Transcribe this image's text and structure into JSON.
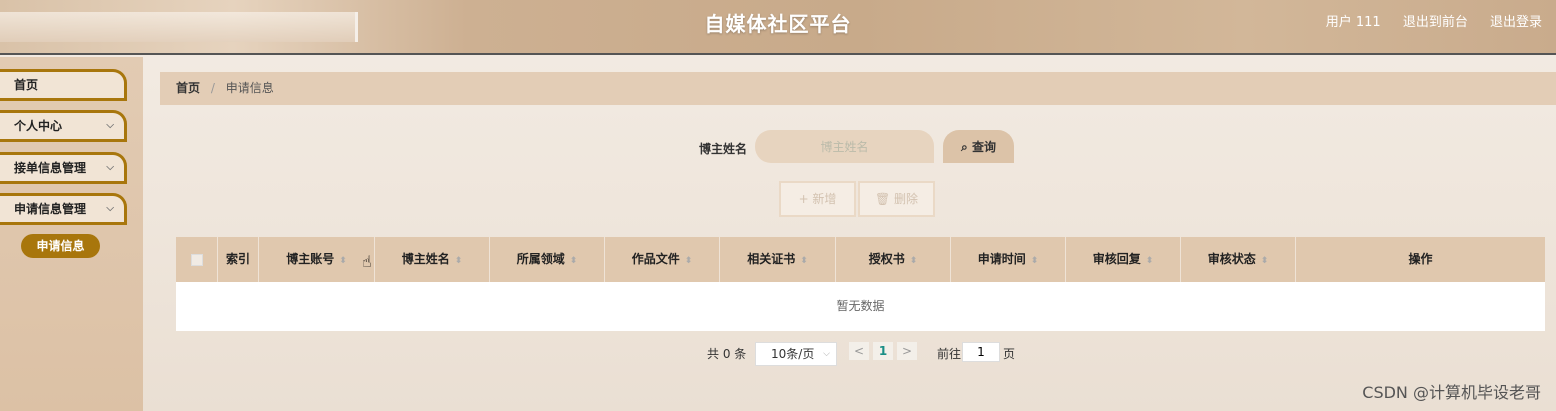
{
  "header": {
    "title": "自媒体社区平台",
    "user": "用户 111",
    "to_front": "退出到前台",
    "logout": "退出登录"
  },
  "sidebar": {
    "items": [
      {
        "label": "首页"
      },
      {
        "label": "个人中心"
      },
      {
        "label": "接单信息管理"
      },
      {
        "label": "申请信息管理"
      }
    ],
    "sub_item": "申请信息"
  },
  "breadcrumb": {
    "home": "首页",
    "separator": "/",
    "current": "申请信息"
  },
  "search": {
    "label": "博主姓名",
    "placeholder": "博主姓名",
    "button": "查询"
  },
  "actions": {
    "add": "+ 新增",
    "delete": "删除"
  },
  "table": {
    "columns": [
      "索引",
      "博主账号",
      "博主姓名",
      "所属领域",
      "作品文件",
      "相关证书",
      "授权书",
      "申请时间",
      "审核回复",
      "审核状态",
      "操作"
    ],
    "empty": "暂无数据"
  },
  "pagination": {
    "total": "共 0 条",
    "page_size": "10条/页",
    "prev": "<",
    "current_page": "1",
    "next": ">",
    "goto_label": "前往",
    "goto_value": "1",
    "page_suffix": "页"
  },
  "watermark": "CSDN @计算机毕设老哥"
}
